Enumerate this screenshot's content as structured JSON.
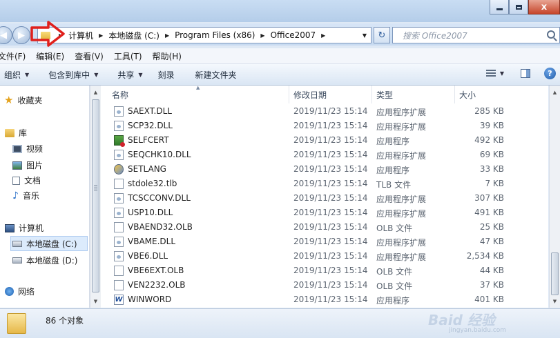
{
  "window": {
    "buttons": {
      "minimize": "–",
      "maximize": "□",
      "close": "x"
    }
  },
  "nav": {
    "back": "◀",
    "forward": "▶",
    "crumbs": [
      "计算机",
      "本地磁盘 (C:)",
      "Program Files (x86)",
      "Office2007"
    ],
    "refresh": "↻",
    "search_placeholder": "搜索 Office2007"
  },
  "menu": [
    "文件(F)",
    "编辑(E)",
    "查看(V)",
    "工具(T)",
    "帮助(H)"
  ],
  "toolbar": [
    "组织",
    "包含到库中",
    "共享",
    "刻录",
    "新建文件夹"
  ],
  "navpane": {
    "favorites": "收藏夹",
    "libraries": "库",
    "lib_items": [
      "视频",
      "图片",
      "文档",
      "音乐"
    ],
    "computer": "计算机",
    "drives": [
      "本地磁盘 (C:)",
      "本地磁盘 (D:)"
    ],
    "network": "网络"
  },
  "columns": {
    "name": "名称",
    "date": "修改日期",
    "type": "类型",
    "size": "大小"
  },
  "files": [
    {
      "name": "SAEXT.DLL",
      "date": "2019/11/23 15:14",
      "type": "应用程序扩展",
      "size": "285 KB",
      "icon": "dll-icon"
    },
    {
      "name": "SCP32.DLL",
      "date": "2019/11/23 15:14",
      "type": "应用程序扩展",
      "size": "39 KB",
      "icon": "dll-icon"
    },
    {
      "name": "SELFCERT",
      "date": "2019/11/23 15:14",
      "type": "应用程序",
      "size": "492 KB",
      "icon": "cert-icon"
    },
    {
      "name": "SEQCHK10.DLL",
      "date": "2019/11/23 15:14",
      "type": "应用程序扩展",
      "size": "69 KB",
      "icon": "dll-icon"
    },
    {
      "name": "SETLANG",
      "date": "2019/11/23 15:14",
      "type": "应用程序",
      "size": "33 KB",
      "icon": "lang-icon"
    },
    {
      "name": "stdole32.tlb",
      "date": "2019/11/23 15:14",
      "type": "TLB 文件",
      "size": "7 KB",
      "icon": "doc-icon"
    },
    {
      "name": "TCSCCONV.DLL",
      "date": "2019/11/23 15:14",
      "type": "应用程序扩展",
      "size": "307 KB",
      "icon": "dll-icon"
    },
    {
      "name": "USP10.DLL",
      "date": "2019/11/23 15:14",
      "type": "应用程序扩展",
      "size": "491 KB",
      "icon": "dll-icon"
    },
    {
      "name": "VBAEND32.OLB",
      "date": "2019/11/23 15:14",
      "type": "OLB 文件",
      "size": "25 KB",
      "icon": "doc-icon"
    },
    {
      "name": "VBAME.DLL",
      "date": "2019/11/23 15:14",
      "type": "应用程序扩展",
      "size": "47 KB",
      "icon": "dll-icon"
    },
    {
      "name": "VBE6.DLL",
      "date": "2019/11/23 15:14",
      "type": "应用程序扩展",
      "size": "2,534 KB",
      "icon": "dll-icon"
    },
    {
      "name": "VBE6EXT.OLB",
      "date": "2019/11/23 15:14",
      "type": "OLB 文件",
      "size": "44 KB",
      "icon": "doc-icon"
    },
    {
      "name": "VEN2232.OLB",
      "date": "2019/11/23 15:14",
      "type": "OLB 文件",
      "size": "37 KB",
      "icon": "doc-icon"
    },
    {
      "name": "WINWORD",
      "date": "2019/11/23 15:14",
      "type": "应用程序",
      "size": "401 KB",
      "icon": "word-icon"
    }
  ],
  "status": {
    "count": "86 个对象"
  },
  "watermark": {
    "main": "Baid 经验",
    "sub": "jingyan.baidu.com"
  },
  "colors": {
    "annotation_arrow": "#e0201c",
    "selection": "#dcebfc"
  }
}
